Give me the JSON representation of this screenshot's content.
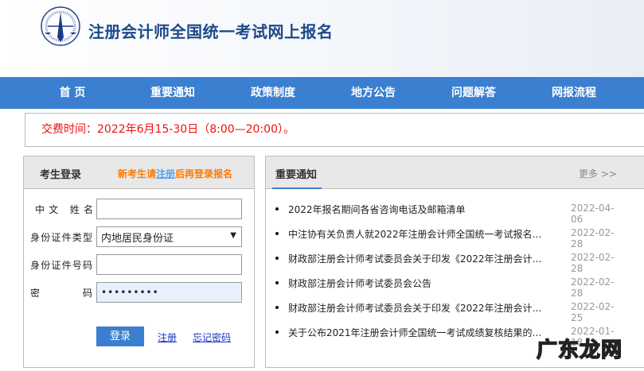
{
  "header": {
    "title": "注册会计师全国统一考试网上报名"
  },
  "nav": {
    "items": [
      "首 页",
      "重要通知",
      "政策制度",
      "地方公告",
      "问题解答",
      "网报流程"
    ]
  },
  "notice": {
    "text": "交费时间：2022年6月15-30日（8:00—20:00）。"
  },
  "login": {
    "title": "考生登录",
    "tip_prefix": "新考生请",
    "tip_link": "注册",
    "tip_suffix": "后再登录报名",
    "fields": [
      {
        "label": "中文 姓名",
        "value": ""
      },
      {
        "label": "身份证件类型",
        "value": "内地居民身份证"
      },
      {
        "label": "身份证件号码",
        "value": ""
      },
      {
        "label": "密 码",
        "value": "•••••••••"
      }
    ],
    "login_button": "登录",
    "register_link": "注册",
    "forgot_link": "忘记密码"
  },
  "news": {
    "title": "重要通知",
    "more": "更多 >>",
    "items": [
      {
        "title": "2022年报名期间各省咨询电话及邮箱清单",
        "date": "2022-04-06"
      },
      {
        "title": "中注协有关负责人就2022年注册会计师全国统一考试报名相...",
        "date": "2022-02-28"
      },
      {
        "title": "财政部注册会计师考试委员会关于印发《2022年注册会计师...",
        "date": "2022-02-28"
      },
      {
        "title": "财政部注册会计师考试委员会公告",
        "date": "2022-02-28"
      },
      {
        "title": "财政部注册会计师考试委员会关于印发《2022年注册会计师...",
        "date": "2022-02-25"
      },
      {
        "title": "关于公布2021年注册会计师全国统一考试成绩复核结果的公...",
        "date": "2022-01-18"
      }
    ]
  },
  "watermark": "广东龙网",
  "colors": {
    "nav": "#3a7fd0",
    "notice": "#f01010",
    "tip": "#ff7a00",
    "title": "#1d4a8a"
  }
}
